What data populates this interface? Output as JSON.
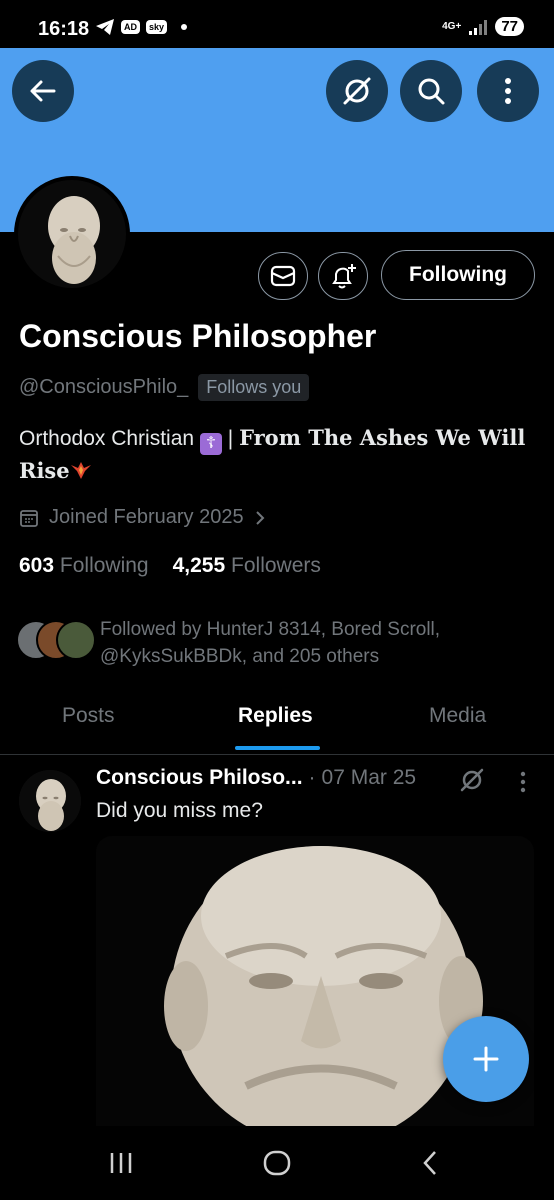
{
  "status_bar": {
    "time": "16:18",
    "badge_ad": "AD",
    "badge_sky": "sky",
    "network": "4G+",
    "battery": "77"
  },
  "profile": {
    "name": "Conscious Philosopher",
    "handle": "@ConsciousPhilo_",
    "follows_you": "Follows you",
    "bio_prefix": "Orthodox Christian",
    "bio_cross": "☦",
    "bio_separator": "|",
    "bio_fancy": "From The Ashes We Will Rise",
    "joined": "Joined February 2025",
    "following_count": "603",
    "following_label": "Following",
    "followers_count": "4,255",
    "followers_label": "Followers",
    "followed_by": "Followed by HunterJ 8314, Bored Scroll, @KyksSukBBDk, and 205 others",
    "follow_button": "Following"
  },
  "tabs": [
    {
      "label": "Posts"
    },
    {
      "label": "Replies",
      "active": true
    },
    {
      "label": "Media"
    }
  ],
  "tweet": {
    "author": "Conscious Philoso...",
    "separator": "·",
    "date": "07 Mar 25",
    "text": "Did you miss me?"
  },
  "colors": {
    "banner": "#4f9ff0",
    "accent": "#1d9bf0",
    "fab": "#4a9ee8"
  }
}
